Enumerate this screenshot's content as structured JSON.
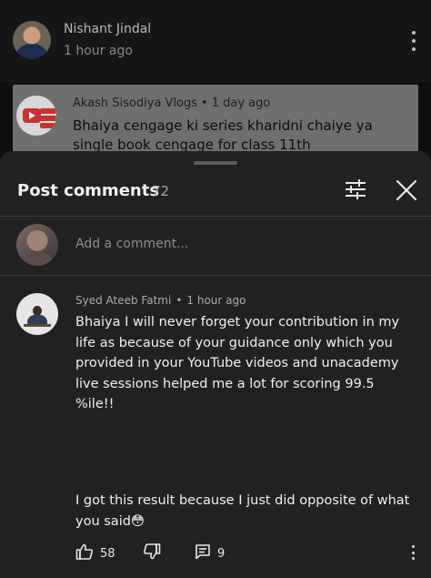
{
  "post": {
    "author": "Nishant Jindal",
    "time": "1 hour ago",
    "shared": {
      "channel": "Akash Sisodiya Vlogs",
      "separator": "•",
      "time": "1 day ago",
      "title": "Bhaiya cengage ki series kharidni chaiye ya single book cengage for class 11th"
    }
  },
  "sheet": {
    "title": "Post comments",
    "count": "72",
    "input_placeholder": "Add a comment..."
  },
  "comment": {
    "author": "Syed Ateeb Fatmi",
    "separator": "•",
    "time": "1 hour ago",
    "text": "Bhaiya I will never forget your contribution in my life as because of your guidance only which you provided in your YouTube videos and unacademy live sessions helped me a lot for scoring 99.5 %ile!!",
    "text_continued": "I got this result because I just did opposite of what you said😳",
    "likes": "58",
    "replies": "9"
  },
  "icons": {
    "post_menu": "more-vertical-icon",
    "filter": "sliders-icon",
    "close": "close-icon",
    "like": "thumbs-up-icon",
    "dislike": "thumbs-down-icon",
    "reply": "comment-icon",
    "comment_menu": "more-vertical-icon"
  },
  "colors": {
    "sheet_bg": "#212121",
    "page_bg": "#0f0f0f",
    "text_primary": "#f1f1f1",
    "text_secondary": "#aaaaaa"
  }
}
